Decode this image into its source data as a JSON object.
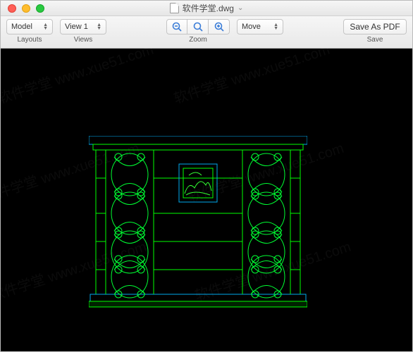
{
  "window": {
    "title": "软件学堂.dwg",
    "title_chevron": "⌄"
  },
  "toolbar": {
    "layouts": {
      "label": "Layouts",
      "value": "Model"
    },
    "views": {
      "label": "Views",
      "value": "View 1"
    },
    "zoom": {
      "label": "Zoom"
    },
    "move": {
      "label": "",
      "value": "Move"
    },
    "save": {
      "label": "Save",
      "button": "Save As PDF"
    }
  },
  "watermark": {
    "text": "软件学堂 www.xue51.com"
  }
}
